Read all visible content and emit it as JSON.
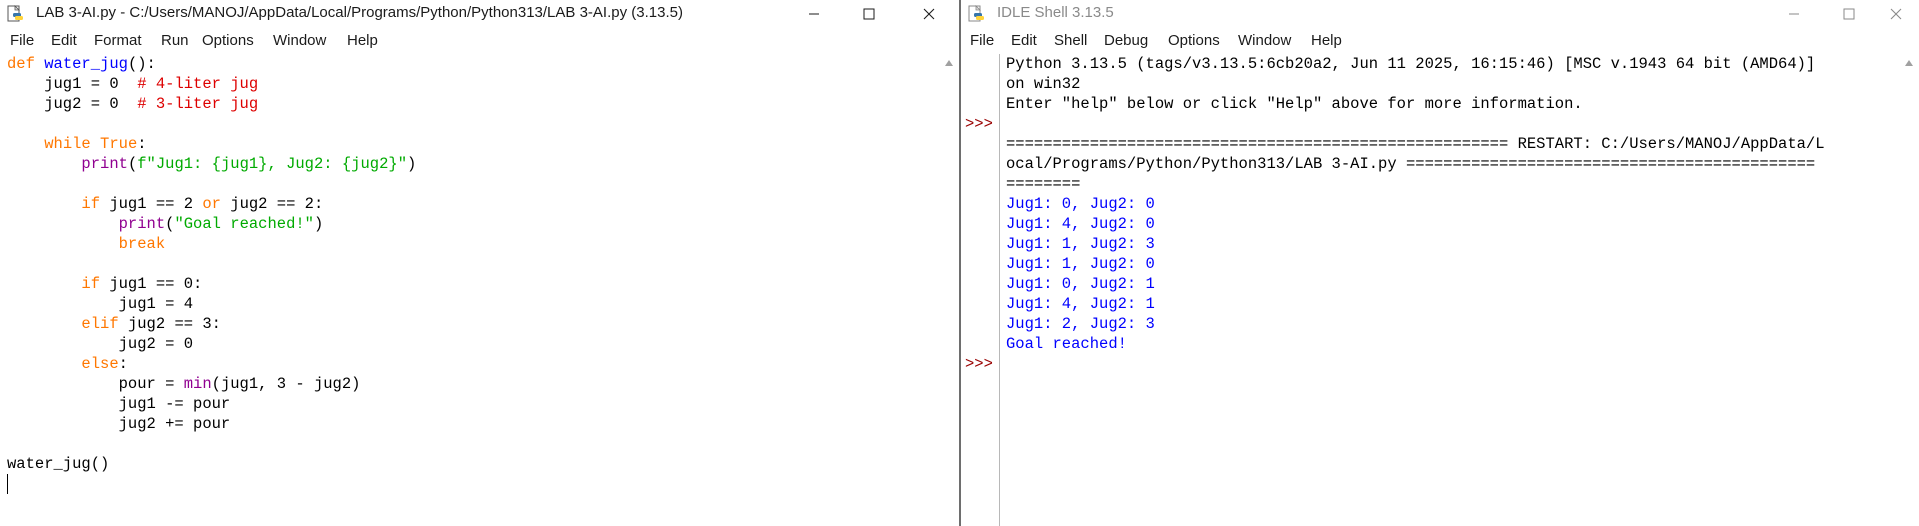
{
  "editor": {
    "title": "LAB 3-AI.py - C:/Users/MANOJ/AppData/Local/Programs/Python/Python313/LAB 3-AI.py (3.13.5)",
    "menu": [
      "File",
      "Edit",
      "Format",
      "Run",
      "Options",
      "Window",
      "Help"
    ],
    "code": [
      [
        {
          "t": "def",
          "c": "kw"
        },
        {
          "t": " "
        },
        {
          "t": "water_jug",
          "c": "def"
        },
        {
          "t": "():"
        }
      ],
      [
        {
          "t": "    jug1 = 0  "
        },
        {
          "t": "# 4-liter jug",
          "c": "com"
        }
      ],
      [
        {
          "t": "    jug2 = 0  "
        },
        {
          "t": "# 3-liter jug",
          "c": "com"
        }
      ],
      [],
      [
        {
          "t": "    "
        },
        {
          "t": "while",
          "c": "kw"
        },
        {
          "t": " "
        },
        {
          "t": "True",
          "c": "kw"
        },
        {
          "t": ":"
        }
      ],
      [
        {
          "t": "        "
        },
        {
          "t": "print",
          "c": "bi"
        },
        {
          "t": "("
        },
        {
          "t": "f\"Jug1: {jug1}, Jug2: {jug2}\"",
          "c": "str"
        },
        {
          "t": ")"
        }
      ],
      [],
      [
        {
          "t": "        "
        },
        {
          "t": "if",
          "c": "kw"
        },
        {
          "t": " jug1 == 2 "
        },
        {
          "t": "or",
          "c": "kw"
        },
        {
          "t": " jug2 == 2:"
        }
      ],
      [
        {
          "t": "            "
        },
        {
          "t": "print",
          "c": "bi"
        },
        {
          "t": "("
        },
        {
          "t": "\"Goal reached!\"",
          "c": "str"
        },
        {
          "t": ")"
        }
      ],
      [
        {
          "t": "            "
        },
        {
          "t": "break",
          "c": "kw"
        }
      ],
      [],
      [
        {
          "t": "        "
        },
        {
          "t": "if",
          "c": "kw"
        },
        {
          "t": " jug1 == 0:"
        }
      ],
      [
        {
          "t": "            jug1 = 4"
        }
      ],
      [
        {
          "t": "        "
        },
        {
          "t": "elif",
          "c": "kw"
        },
        {
          "t": " jug2 == 3:"
        }
      ],
      [
        {
          "t": "            jug2 = 0"
        }
      ],
      [
        {
          "t": "        "
        },
        {
          "t": "else",
          "c": "kw"
        },
        {
          "t": ":"
        }
      ],
      [
        {
          "t": "            pour = "
        },
        {
          "t": "min",
          "c": "bi"
        },
        {
          "t": "(jug1, 3 - jug2)"
        }
      ],
      [
        {
          "t": "            jug1 -= pour"
        }
      ],
      [
        {
          "t": "            jug2 += pour"
        }
      ],
      [],
      [
        {
          "t": "water_jug()"
        }
      ],
      []
    ]
  },
  "shell": {
    "title": "IDLE Shell 3.13.5",
    "menu": [
      "File",
      "Edit",
      "Shell",
      "Debug",
      "Options",
      "Window",
      "Help"
    ],
    "prompts": [
      ">>>",
      ">>>"
    ],
    "lines": [
      {
        "t": "Python 3.13.5 (tags/v3.13.5:6cb20a2, Jun 11 2025, 16:15:46) [MSC v.1943 64 bit (AMD64)]",
        "c": "hdr"
      },
      {
        "t": "on win32",
        "c": "hdr"
      },
      {
        "t": "Enter \"help\" below or click \"Help\" above for more information.",
        "c": "hdr"
      },
      {
        "t": "",
        "c": "hdr"
      },
      {
        "t": "====================================================== RESTART: C:/Users/MANOJ/AppData/L",
        "c": "hdr"
      },
      {
        "t": "ocal/Programs/Python/Python313/LAB 3-AI.py ============================================",
        "c": "hdr"
      },
      {
        "t": "========",
        "c": "hdr"
      },
      {
        "t": "Jug1: 0, Jug2: 0",
        "c": "out"
      },
      {
        "t": "Jug1: 4, Jug2: 0",
        "c": "out"
      },
      {
        "t": "Jug1: 1, Jug2: 3",
        "c": "out"
      },
      {
        "t": "Jug1: 1, Jug2: 0",
        "c": "out"
      },
      {
        "t": "Jug1: 0, Jug2: 1",
        "c": "out"
      },
      {
        "t": "Jug1: 4, Jug2: 1",
        "c": "out"
      },
      {
        "t": "Jug1: 2, Jug2: 3",
        "c": "out"
      },
      {
        "t": "Goal reached!",
        "c": "out"
      }
    ]
  },
  "icons": {
    "app": "python-file-icon",
    "minimize": "minimize-icon",
    "maximize": "maximize-icon",
    "close": "close-icon",
    "scroll_up": "scroll-up-arrow-icon"
  },
  "colors": {
    "keyword": "#ff7700",
    "definition": "#0000ff",
    "builtin": "#900090",
    "string": "#00aa00",
    "comment": "#dd0000",
    "shell_output": "#0000ff",
    "shell_prompt": "#990000"
  }
}
